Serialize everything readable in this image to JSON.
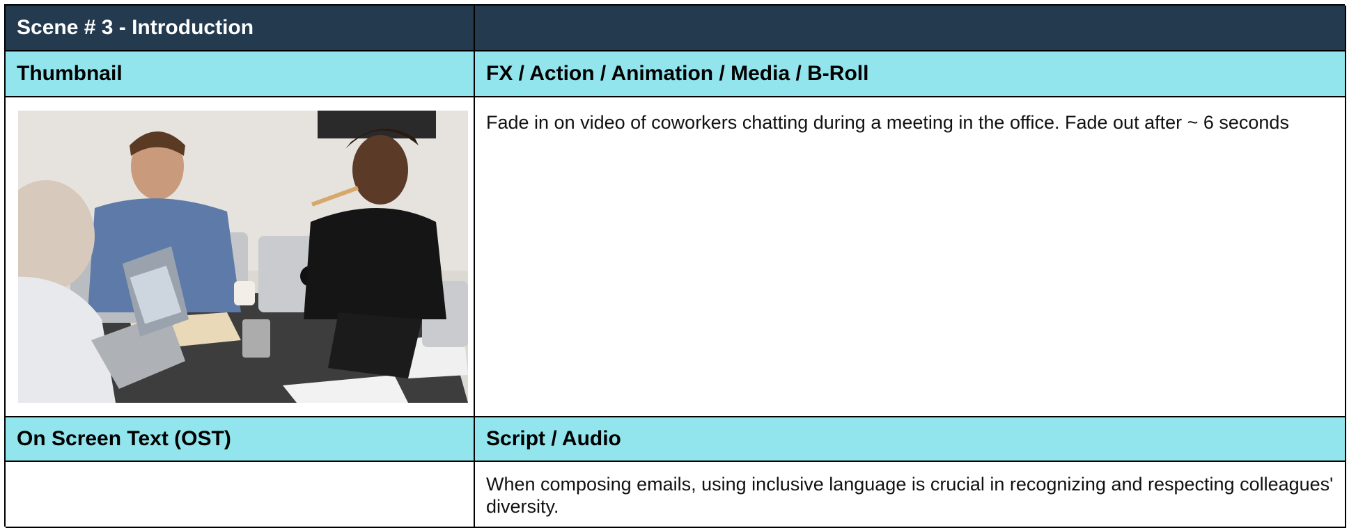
{
  "scene": {
    "title": "Scene # 3 - Introduction"
  },
  "headers": {
    "thumbnail": "Thumbnail",
    "fx": "FX / Action / Animation / Media / B-Roll",
    "ost": "On Screen Text (OST)",
    "script": "Script / Audio"
  },
  "content": {
    "fx_text": "Fade in on video of coworkers chatting during a meeting in the office. Fade out after ~ 6 seconds",
    "ost_text": "",
    "script_text": "When composing emails, using inclusive language is crucial in recognizing and respecting colleagues' diversity."
  },
  "thumbnail": {
    "image": "office-meeting-photo"
  }
}
